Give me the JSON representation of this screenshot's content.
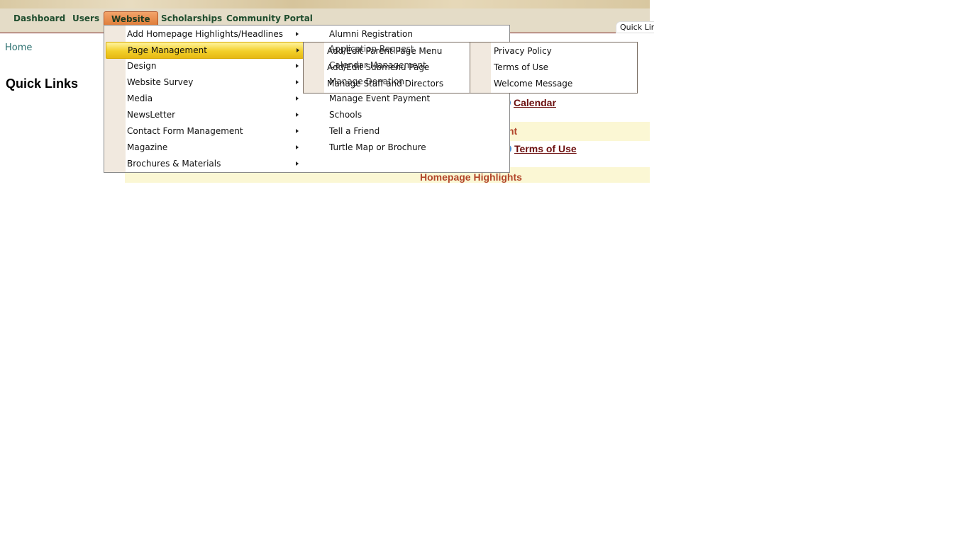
{
  "nav": {
    "items": [
      {
        "label": "Dashboard"
      },
      {
        "label": "Users"
      },
      {
        "label": "Website"
      },
      {
        "label": "Scholarships"
      },
      {
        "label": "Community Portal"
      }
    ],
    "quick_links_tab": "Quick Lin"
  },
  "breadcrumb": {
    "home": "Home"
  },
  "page": {
    "title": "Quick Links"
  },
  "content": {
    "calendar_link": "Calendar",
    "partial_heading": "nt",
    "terms_link": "Terms of Use",
    "homepage_highlights": "Homepage Highlights"
  },
  "website_menu": {
    "items": [
      {
        "label": "Add Homepage Highlights/Headlines"
      },
      {
        "label": "Page Management"
      },
      {
        "label": "Design"
      },
      {
        "label": "Website Survey"
      },
      {
        "label": "Media"
      },
      {
        "label": "NewsLetter"
      },
      {
        "label": "Contact Form Management"
      },
      {
        "label": "Magazine"
      },
      {
        "label": "Brochures & Materials"
      }
    ],
    "highlighted": "Page Management"
  },
  "behind_submenu": {
    "items": [
      {
        "label": "Alumni Registration"
      },
      {
        "label": "Application Request"
      },
      {
        "label": "Calendar Management"
      },
      {
        "label": "Manage Donation"
      },
      {
        "label": "Manage Event Payment"
      },
      {
        "label": "Schools"
      },
      {
        "label": "Tell a Friend"
      },
      {
        "label": "Turtle Map or Brochure"
      }
    ]
  },
  "page_management_menu": {
    "items": [
      {
        "label": "Add/Edit Parent Page Menu"
      },
      {
        "label": "Add/Edit Submenu Page"
      },
      {
        "label": "Manage Staff and Directors"
      }
    ]
  },
  "third_menu": {
    "items": [
      {
        "label": "Privacy Policy"
      },
      {
        "label": "Terms of Use"
      },
      {
        "label": "Welcome Message"
      }
    ]
  }
}
